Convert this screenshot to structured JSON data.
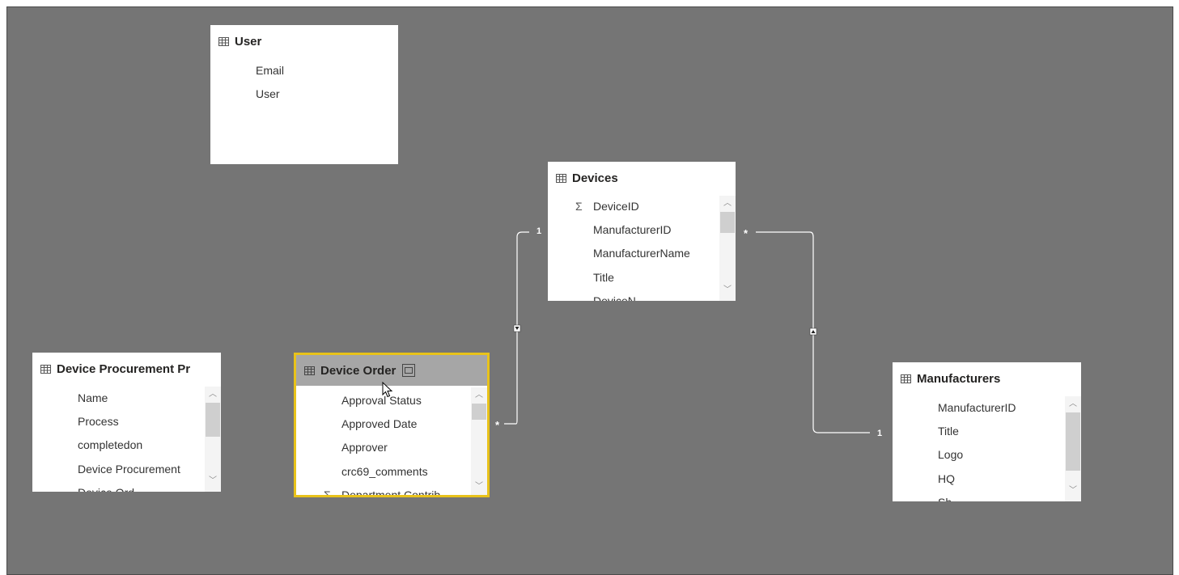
{
  "colors": {
    "canvas": "#757575",
    "card": "#ffffff",
    "selected_border": "#e8c21a",
    "selected_header": "#a6a6a6",
    "line": "#ffffff"
  },
  "tables": {
    "user": {
      "title": "User",
      "fields": [
        "Email",
        "User"
      ]
    },
    "devices": {
      "title": "Devices",
      "fields": [
        "DeviceID",
        "ManufacturerID",
        "ManufacturerName",
        "Title",
        "DeviceN..."
      ]
    },
    "procurement": {
      "title": "Device Procurement Pr",
      "fields": [
        "Name",
        "Process",
        "completedon",
        "Device Procurement",
        "Device Ord..."
      ]
    },
    "order": {
      "title": "Device Order",
      "fields": [
        "Approval Status",
        "Approved Date",
        "Approver",
        "crc69_comments",
        "Department Contrib..."
      ]
    },
    "manufacturers": {
      "title": "Manufacturers",
      "fields": [
        "ManufacturerID",
        "Title",
        "Logo",
        "HQ",
        "Sh..."
      ]
    }
  },
  "relationships": {
    "order_devices": {
      "one": "1",
      "many": "*"
    },
    "devices_manufacturers": {
      "one": "1",
      "many": "*"
    }
  },
  "icons": [
    "table-icon",
    "sigma-icon",
    "pointer-cursor-icon",
    "expand-icon"
  ]
}
